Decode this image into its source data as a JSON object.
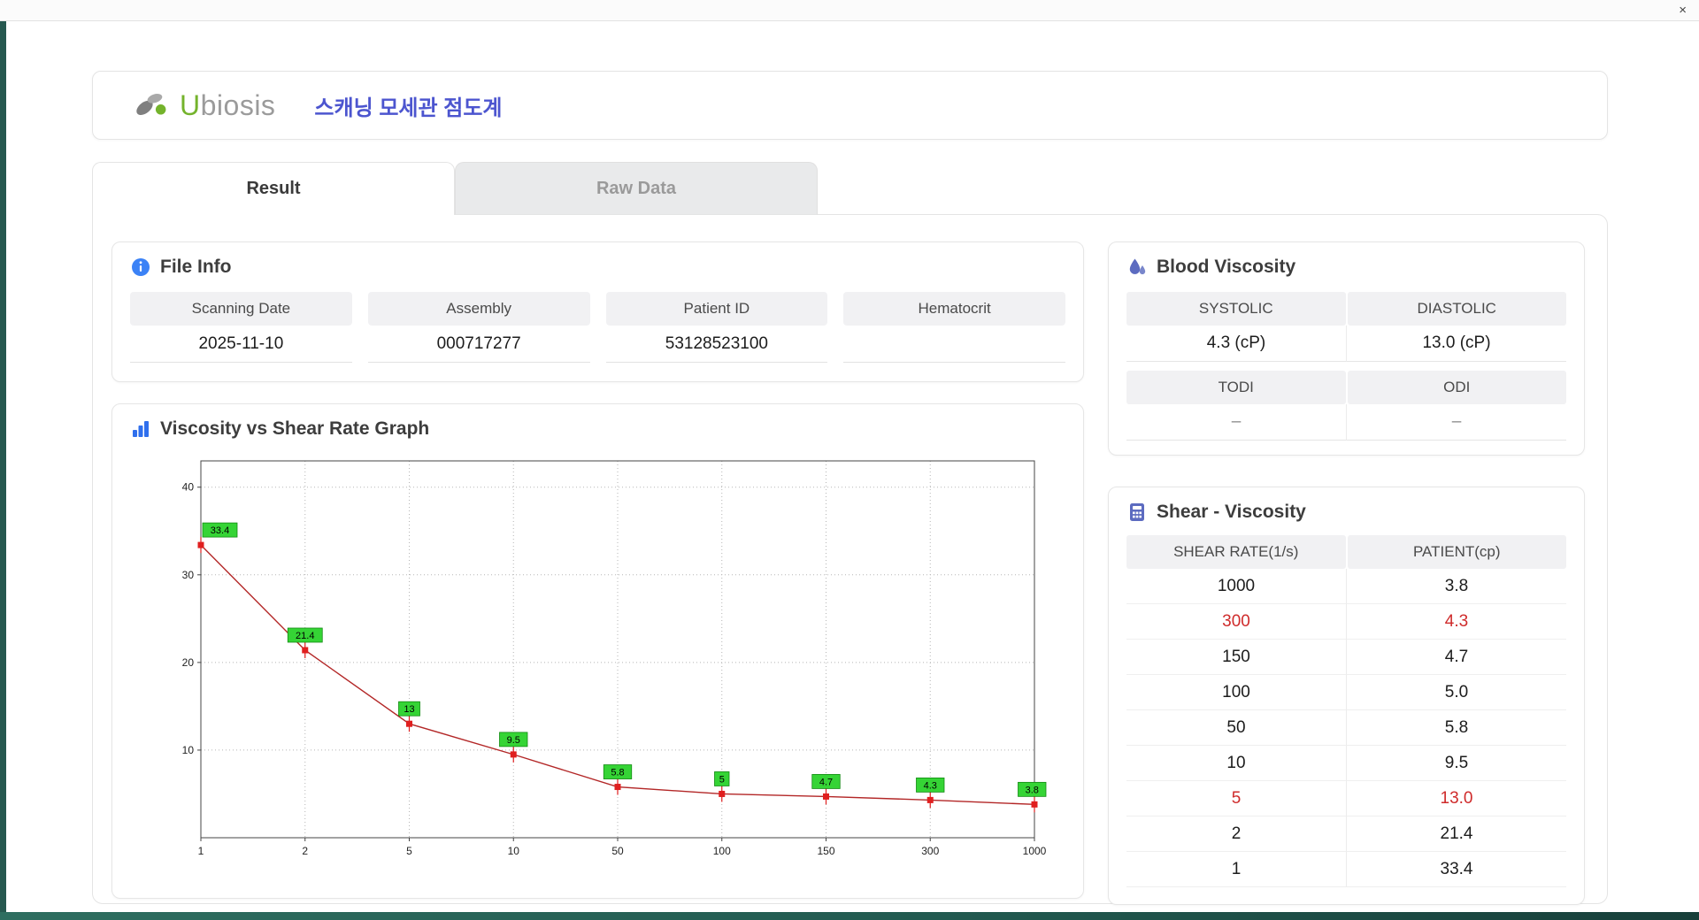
{
  "window": {
    "close_label": "×"
  },
  "header": {
    "logo_u": "U",
    "logo_rest": "biosis",
    "title": "스캐닝 모세관 점도계"
  },
  "tabs": [
    {
      "label": "Result"
    },
    {
      "label": "Raw Data"
    }
  ],
  "file_info": {
    "title": "File Info",
    "fields": [
      {
        "label": "Scanning Date",
        "value": "2025-11-10"
      },
      {
        "label": "Assembly",
        "value": "000717277"
      },
      {
        "label": "Patient ID",
        "value": "53128523100"
      },
      {
        "label": "Hematocrit",
        "value": ""
      }
    ]
  },
  "blood_viscosity": {
    "title": "Blood Viscosity",
    "sections": [
      {
        "headers": [
          "SYSTOLIC",
          "DIASTOLIC"
        ],
        "values": [
          "4.3 (cP)",
          "13.0 (cP)"
        ],
        "dash": false
      },
      {
        "headers": [
          "TODI",
          "ODI"
        ],
        "values": [
          "–",
          "–"
        ],
        "dash": true
      }
    ]
  },
  "shear_viscosity": {
    "title": "Shear - Viscosity",
    "columns": [
      "SHEAR RATE(1/s)",
      "PATIENT(cp)"
    ],
    "rows": [
      {
        "shear": "1000",
        "patient": "3.8",
        "highlight": false
      },
      {
        "shear": "300",
        "patient": "4.3",
        "highlight": true
      },
      {
        "shear": "150",
        "patient": "4.7",
        "highlight": false
      },
      {
        "shear": "100",
        "patient": "5.0",
        "highlight": false
      },
      {
        "shear": "50",
        "patient": "5.8",
        "highlight": false
      },
      {
        "shear": "10",
        "patient": "9.5",
        "highlight": false
      },
      {
        "shear": "5",
        "patient": "13.0",
        "highlight": true
      },
      {
        "shear": "2",
        "patient": "21.4",
        "highlight": false
      },
      {
        "shear": "1",
        "patient": "33.4",
        "highlight": false
      }
    ]
  },
  "graph": {
    "title": "Viscosity vs Shear Rate Graph"
  },
  "chart_data": {
    "type": "line",
    "title": "Viscosity vs Shear Rate Graph",
    "xlabel": "",
    "ylabel": "",
    "x_categories": [
      "1",
      "2",
      "5",
      "10",
      "50",
      "100",
      "150",
      "300",
      "1000"
    ],
    "values": [
      33.4,
      21.4,
      13,
      9.5,
      5.8,
      5,
      4.7,
      4.3,
      3.8
    ],
    "point_labels": [
      "33.4",
      "21.4",
      "13",
      "9.5",
      "5.8",
      "5",
      "4.7",
      "4.3",
      "3.8"
    ],
    "yticks": [
      10,
      20,
      30,
      40
    ],
    "ylim": [
      0,
      43
    ],
    "grid": "dotted",
    "legend": "none",
    "line_color": "#b32727",
    "marker_color": "#e01f1f",
    "label_bg": "#35d435",
    "label_border": "#128a12",
    "axis_color": "#444444",
    "grid_color": "#b5b5b5"
  }
}
